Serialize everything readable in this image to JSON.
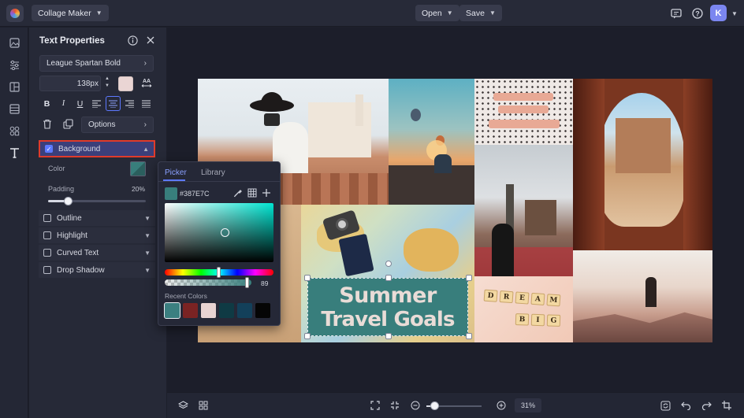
{
  "app": {
    "project_menu": "Collage Maker",
    "open_label": "Open",
    "save_label": "Save",
    "avatar_initial": "K"
  },
  "panel": {
    "title": "Text Properties",
    "font_name": "League Spartan Bold",
    "font_size": "138px",
    "options_label": "Options",
    "background": {
      "label": "Background",
      "color_label": "Color",
      "padding_label": "Padding",
      "padding_value": "20%",
      "padding_fraction": 0.2,
      "color": "#387E7C"
    },
    "sections": [
      {
        "label": "Outline"
      },
      {
        "label": "Highlight"
      },
      {
        "label": "Curved Text"
      },
      {
        "label": "Drop Shadow"
      }
    ]
  },
  "picker": {
    "tab_picker": "Picker",
    "tab_library": "Library",
    "hex": "#387E7C",
    "alpha_value": "89",
    "recent_label": "Recent Colors",
    "recent_colors": [
      "#3b7f80",
      "#7a2323",
      "#e8d3d2",
      "#0f3a44",
      "#13405a",
      "#050505"
    ]
  },
  "canvas": {
    "headline_line1": "Summer",
    "headline_line2": "Travel Goals",
    "sign_line1": [
      "D",
      "R",
      "E",
      "A",
      "M"
    ],
    "sign_line2": [
      "B",
      "I",
      "G"
    ],
    "zoom": "31%"
  },
  "colors": {
    "accent": "#5d79ff",
    "highlight_border": "#e03b2b",
    "text_bg": "#387E7C"
  }
}
